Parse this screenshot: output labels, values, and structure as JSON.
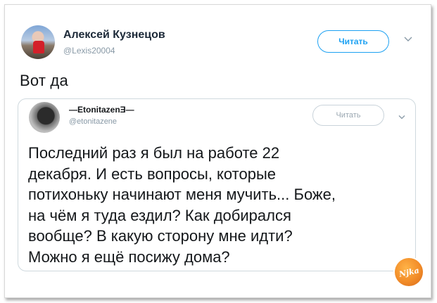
{
  "author": {
    "name": "Алексей Кузнецов",
    "handle": "@Lexis20004",
    "follow_label": "Читать"
  },
  "tweet": {
    "text": "Вот да"
  },
  "quoted": {
    "name": "—EtonitazenƎ—",
    "handle": "@etonitazene",
    "follow_label": "Читать",
    "lines": [
      "Последний раз я был на работе 22",
      "декабря. И есть вопросы, которые",
      "потихоньку начинают меня мучить... Боже,",
      "на чём я туда ездил? Как добирался",
      "вообще? В какую сторону мне идти?",
      "Можно я ещё посижу дома?"
    ]
  },
  "watermark": {
    "text": "Njka"
  },
  "colors": {
    "accent": "#1da1f2",
    "text": "#14171a",
    "muted": "#8899a6",
    "badge": "#f28c28"
  }
}
